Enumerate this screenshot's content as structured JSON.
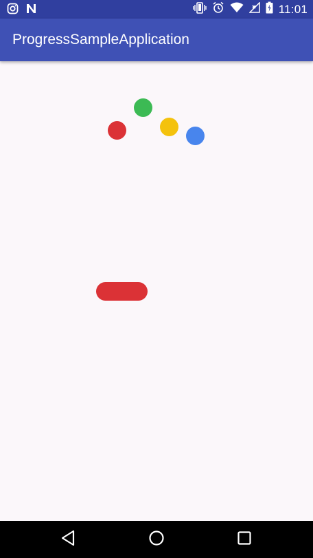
{
  "status_bar": {
    "time": "11:01",
    "left_icons": [
      "instagram-icon",
      "n-notification-icon"
    ],
    "right_icons": [
      "vibrate-icon",
      "alarm-icon",
      "wifi-icon",
      "no-signal-icon",
      "battery-icon"
    ]
  },
  "app_bar": {
    "title": "ProgressSampleApplication"
  },
  "progress": {
    "dot_colors": [
      "#db3236",
      "#3cba54",
      "#f4c20d",
      "#4885ed"
    ],
    "bar_color": "#db3236"
  },
  "nav_bar": {
    "buttons": [
      "back-icon",
      "home-icon",
      "recents-icon"
    ]
  },
  "colors": {
    "status_bar": "#303f9f",
    "app_bar": "#3f51b5",
    "background": "#fbf7fa"
  }
}
